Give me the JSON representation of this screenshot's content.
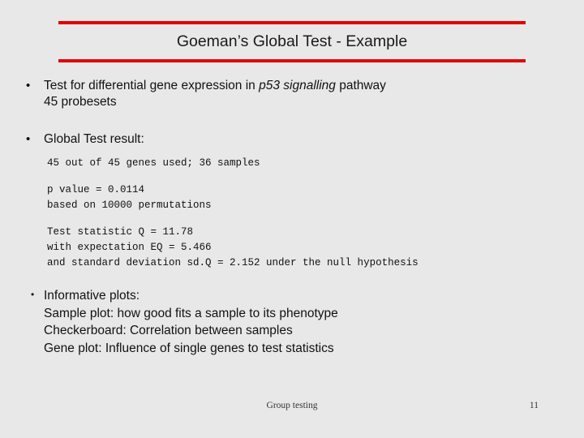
{
  "slide": {
    "title": "Goeman’s Global Test - Example",
    "accent_color": "#e00000",
    "background_color": "#e8e8e8",
    "bullets": {
      "marker_large": "•",
      "marker_small": "•",
      "item1_line1_pre": "Test for differential gene expression in ",
      "item1_line1_italic": "p53 signalling",
      "item1_line1_post": " pathway",
      "item1_line2": "45 probesets",
      "item2": "Global Test result:",
      "item3_line1": "Informative plots:",
      "item3_line2": "Sample plot: how good fits a sample to its phenotype",
      "item3_line3": "Checkerboard: Correlation between samples",
      "item3_line4": "Gene plot: Influence of single genes to test statistics"
    },
    "result": {
      "genes_used": "45 out of 45 genes used; 36 samples",
      "p_value": "p value = 0.0114",
      "permutations": "based on 10000 permutations",
      "test_statistic": "Test statistic Q = 11.78",
      "expectation": "with expectation EQ = 5.466",
      "std_deviation": "and standard deviation sd.Q = 2.152 under the null hypothesis"
    },
    "footer": {
      "center": "Group testing",
      "page_number": "11"
    }
  }
}
